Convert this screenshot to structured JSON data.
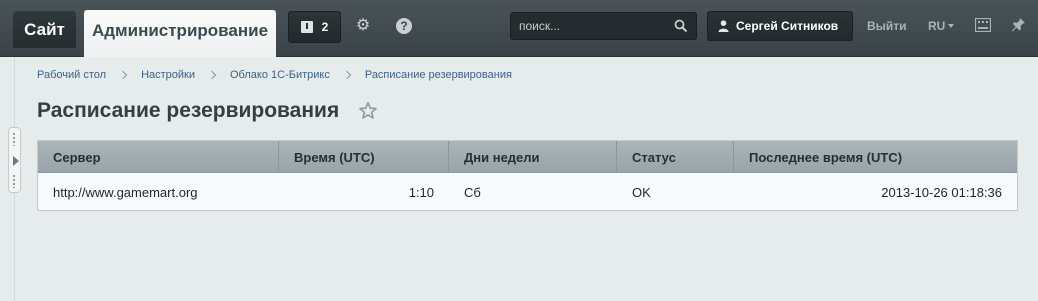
{
  "topbar": {
    "site_tab": "Сайт",
    "admin_tab": "Администрирование",
    "notifications_count": "2",
    "search_placeholder": "поиск...",
    "user_name": "Сергей Ситников",
    "logout": "Выйти",
    "language": "RU"
  },
  "breadcrumb": [
    "Рабочий стол",
    "Настройки",
    "Облако 1С-Битрикс",
    "Расписание резервирования"
  ],
  "page": {
    "title": "Расписание резервирования"
  },
  "table": {
    "columns": [
      "Сервер",
      "Время (UTC)",
      "Дни недели",
      "Статус",
      "Последнее время (UTC)"
    ],
    "rows": [
      {
        "server": "http://www.gamemart.org",
        "time": "1:10",
        "days": "Сб",
        "status": "OK",
        "last_time": "2013-10-26 01:18:36"
      }
    ]
  },
  "icons": {
    "notifications": "notification-icon",
    "settings": "gear-icon",
    "help": "help-icon",
    "search": "search-icon",
    "user": "user-icon",
    "keyboard": "keyboard-icon",
    "pin": "pin-icon",
    "favorite": "star-icon"
  }
}
